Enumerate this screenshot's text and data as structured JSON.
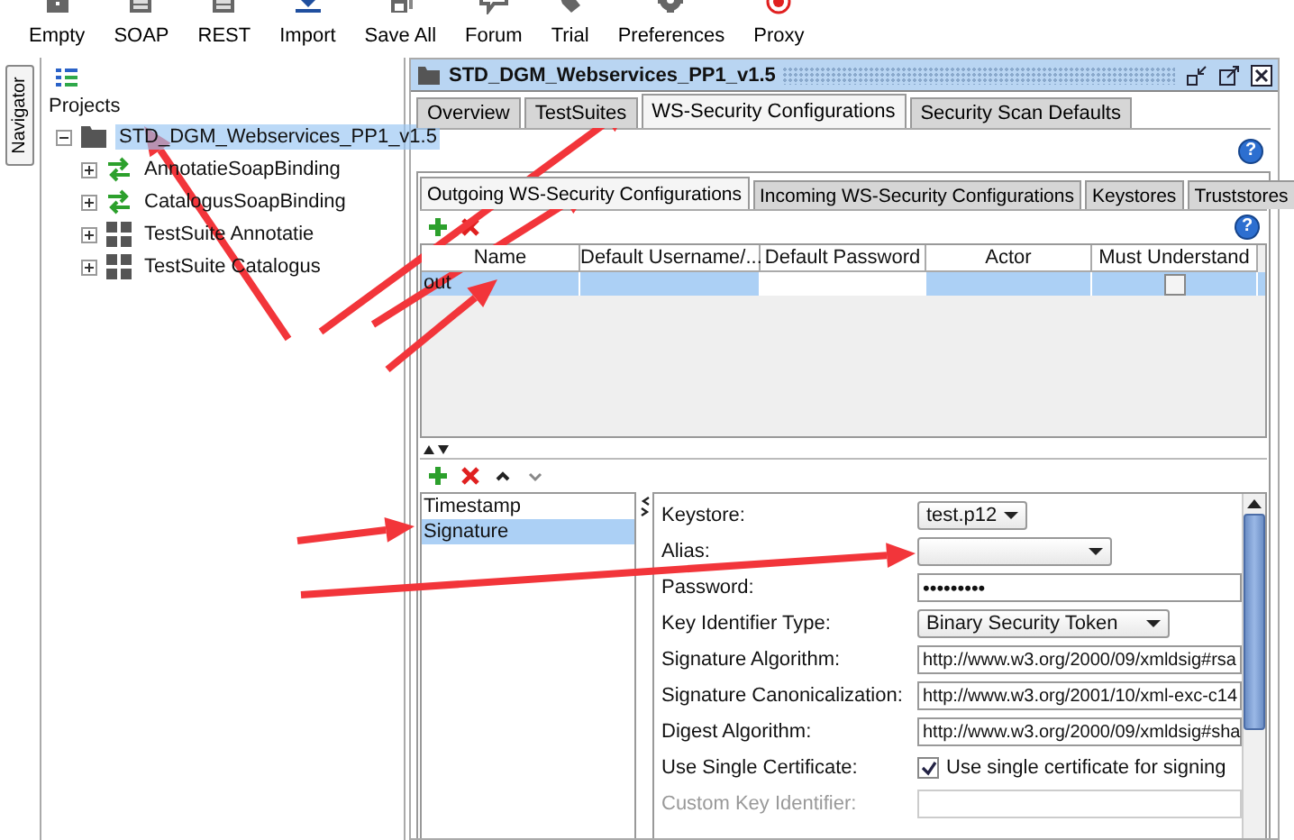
{
  "toolbar": [
    {
      "label": "Empty",
      "kind": "empty"
    },
    {
      "label": "SOAP",
      "kind": "soap"
    },
    {
      "label": "REST",
      "kind": "rest"
    },
    {
      "label": "Import",
      "kind": "import"
    },
    {
      "label": "Save All",
      "kind": "save"
    },
    {
      "label": "Forum",
      "kind": "forum"
    },
    {
      "label": "Trial",
      "kind": "trial"
    },
    {
      "label": "Preferences",
      "kind": "preferences"
    },
    {
      "label": "Proxy",
      "kind": "proxy"
    }
  ],
  "navigator_tab": {
    "label": "Navigator"
  },
  "projects": {
    "heading": "Projects",
    "tree": [
      {
        "label": "STD_DGM_Webservices_PP1_v1.5",
        "kind": "project",
        "selected": true,
        "expanded": true,
        "children": [
          {
            "label": "AnnotatieSoapBinding",
            "kind": "interface",
            "selected": false,
            "expanded": false
          },
          {
            "label": "CatalogusSoapBinding",
            "kind": "interface",
            "selected": false,
            "expanded": false
          },
          {
            "label": "TestSuite Annotatie",
            "kind": "testsuite",
            "selected": false,
            "expanded": false
          },
          {
            "label": "TestSuite Catalogus",
            "kind": "testsuite",
            "selected": false,
            "expanded": false
          }
        ]
      }
    ]
  },
  "editor": {
    "title": "STD_DGM_Webservices_PP1_v1.5",
    "tabs": [
      {
        "label": "Overview",
        "selected": false
      },
      {
        "label": "TestSuites",
        "selected": false
      },
      {
        "label": "WS-Security Configurations",
        "selected": true
      },
      {
        "label": "Security Scan Defaults",
        "selected": false
      }
    ],
    "help": "?",
    "sub_tabs": [
      {
        "label": "Outgoing WS-Security Configurations",
        "selected": true
      },
      {
        "label": "Incoming WS-Security Configurations",
        "selected": false
      },
      {
        "label": "Keystores",
        "selected": false
      },
      {
        "label": "Truststores",
        "selected": false
      }
    ],
    "sub_help": "?",
    "table": {
      "columns": [
        "Name",
        "Default Username/...",
        "Default Password",
        "Actor",
        "Must Understand"
      ],
      "rows": [
        {
          "name": "out",
          "selected": true,
          "must_understand": false
        }
      ]
    },
    "entries": [
      {
        "label": "Timestamp",
        "selected": false
      },
      {
        "label": "Signature",
        "selected": true
      }
    ],
    "form": [
      {
        "label": "Keystore:",
        "kind": "combo",
        "value": "test.p12",
        "disabled": false
      },
      {
        "label": "Alias:",
        "kind": "combo",
        "disabled": false
      },
      {
        "label": "Password:",
        "kind": "password",
        "value": "•••••••••",
        "disabled": false
      },
      {
        "label": "Key Identifier Type:",
        "kind": "combo",
        "value": "Binary Security Token",
        "disabled": false
      },
      {
        "label": "Signature Algorithm:",
        "kind": "text",
        "value": "http://www.w3.org/2000/09/xmldsig#rsa",
        "disabled": false
      },
      {
        "label": "Signature Canonicalization:",
        "kind": "text",
        "value": "http://www.w3.org/2001/10/xml-exc-c14",
        "disabled": false
      },
      {
        "label": "Digest Algorithm:",
        "kind": "text",
        "value": "http://www.w3.org/2000/09/xmldsig#sha",
        "disabled": false
      },
      {
        "label": "Use Single Certificate:",
        "kind": "checkbox",
        "value": "Use single certificate for signing",
        "checked": true,
        "disabled": false
      },
      {
        "label": "Custom Key Identifier:",
        "kind": "text",
        "disabled": true
      }
    ]
  }
}
